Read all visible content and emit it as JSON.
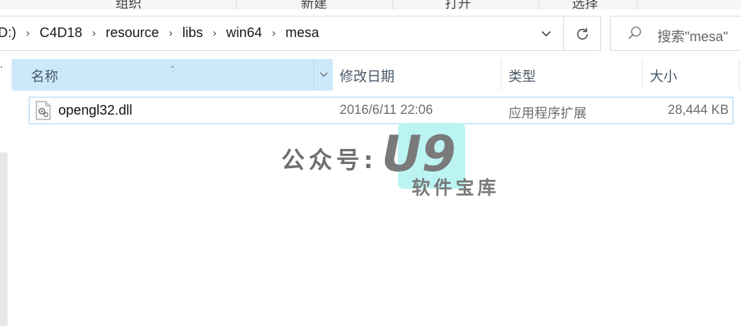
{
  "ribbon": {
    "groups": [
      "组织",
      "新建",
      "打开",
      "选择"
    ]
  },
  "address_bar": {
    "crumbs": [
      "D:)",
      "C4D18",
      "resource",
      "libs",
      "win64",
      "mesa"
    ]
  },
  "search": {
    "placeholder": "搜索\"mesa\""
  },
  "columns": {
    "name": "名称",
    "date": "修改日期",
    "type": "类型",
    "size": "大小"
  },
  "files": [
    {
      "name": "opengl32.dll",
      "modified": "2016/6/11 22:06",
      "type": "应用程序扩展",
      "size": "28,444 KB"
    }
  ],
  "watermark": {
    "prefix": "公众号:",
    "logo": "U9",
    "sub": "软件宝库"
  },
  "colors": {
    "header_selected": "#cce8fb",
    "row_border": "#99d1f7",
    "watermark_bg": "#b7f3f1"
  }
}
